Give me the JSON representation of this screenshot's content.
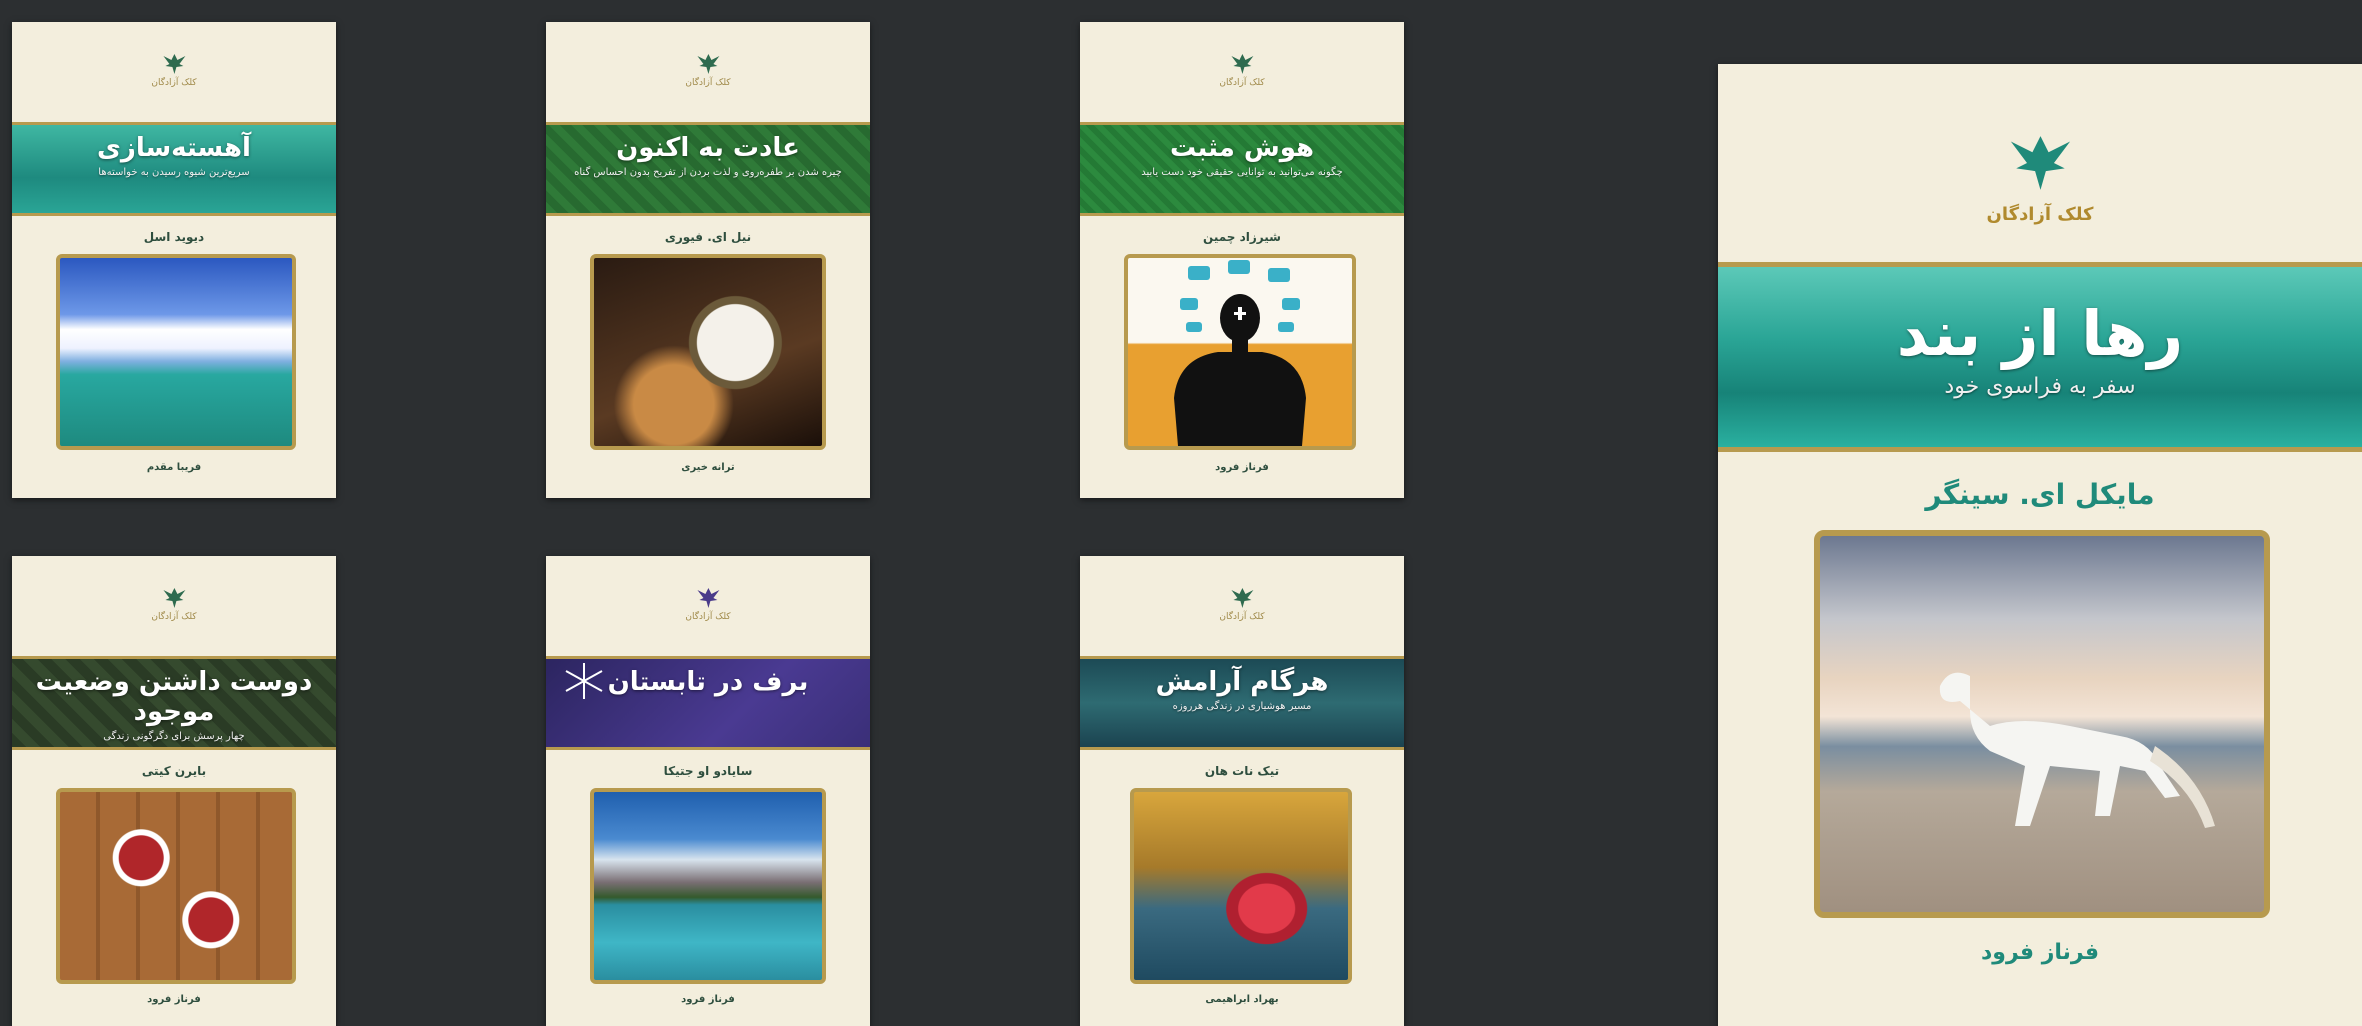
{
  "publisher": "کلک آزادگان",
  "books": [
    {
      "title": "آهسته‌سازی",
      "subtitle": "سریع‌ترین شیوه رسیدن به خواسته‌ها",
      "author": "دیوید اسل",
      "translator": "فریبا مقدم"
    },
    {
      "title": "عادت به اکنون",
      "subtitle": "چیره شدن بر طفره‌روی و لذت بردن از تفریح بدون احساس گناه",
      "author": "نیل ای. فیوری",
      "translator": "ترانه خیری"
    },
    {
      "title": "هوش مثبت",
      "subtitle": "چگونه می‌توانید به توانایی حقیقی خود دست یابید",
      "author": "شیرزاد چمین",
      "translator": "فرناز فرود"
    },
    {
      "title": "دوست داشتن وضعیت موجود",
      "subtitle": "چهار پرسش برای دگرگونی زندگی",
      "author": "بایرن کیتی",
      "translator": "فرناز فرود"
    },
    {
      "title": "برف در تابستان",
      "subtitle": "",
      "author": "سایادو او جتیکا",
      "translator": "فرناز فرود"
    },
    {
      "title": "هرگام آرامش",
      "subtitle": "مسیر هوشیاری در زندگی هرروزه",
      "author": "تیک نات هان",
      "translator": "بهراد ابراهیمی"
    }
  ],
  "featured": {
    "title": "رها از بند",
    "subtitle": "سفر به فراسوی خود",
    "author": "مایکل ای. سینگر",
    "translator": "فرناز فرود",
    "publisher": "کلک آزادگان"
  }
}
